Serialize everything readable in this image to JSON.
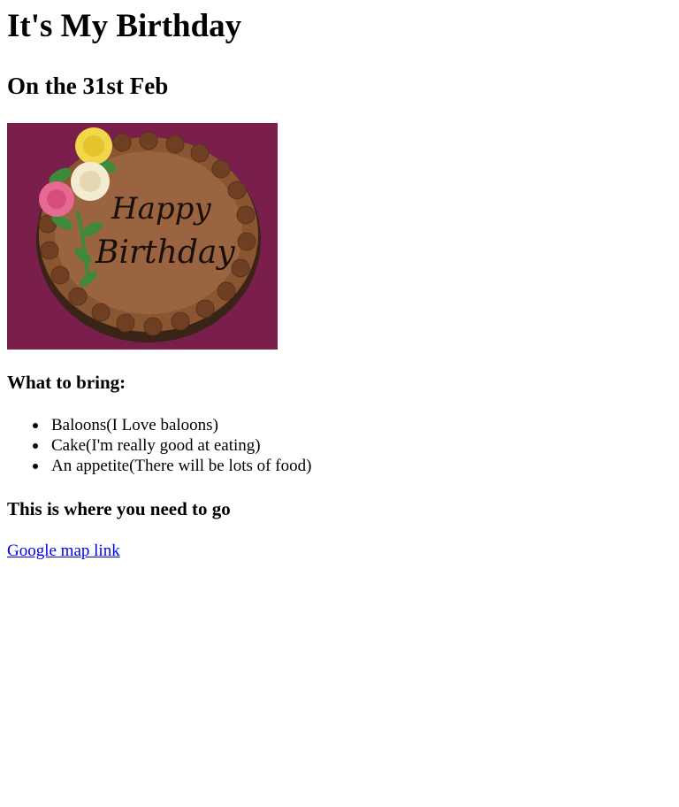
{
  "heading": {
    "title": "It's My Birthday",
    "subtitle": "On the 31st Feb"
  },
  "image": {
    "cake_text_line1": "Happy",
    "cake_text_line2": "Birthday",
    "background_color": "#7a1f4c",
    "frosting_color": "#7b4a2b"
  },
  "bring": {
    "heading": "What to bring:",
    "items": [
      "Baloons(I Love baloons)",
      "Cake(I'm really good at eating)",
      "An appetite(There will be lots of food)"
    ]
  },
  "directions": {
    "heading": "This is where you need to go",
    "link_label": "Google map link"
  }
}
